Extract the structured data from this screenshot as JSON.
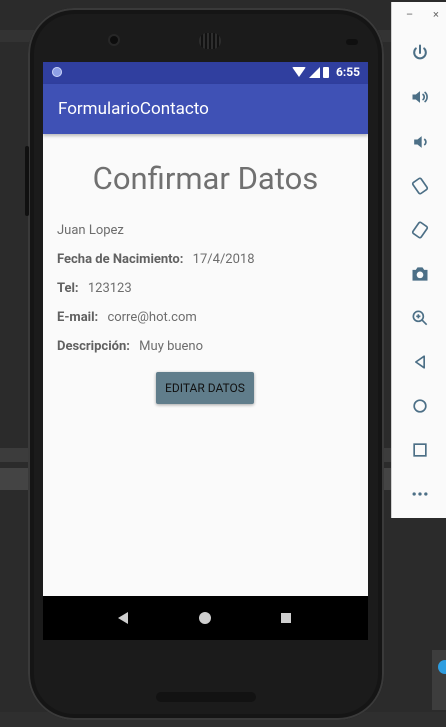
{
  "status_bar": {
    "time": "6:55"
  },
  "app_bar": {
    "title": "FormularioContacto"
  },
  "screen": {
    "heading": "Confirmar Datos",
    "name": "Juan Lopez",
    "birth_label": "Fecha de Nacimiento:",
    "birth_value": "17/4/2018",
    "tel_label": "Tel:",
    "tel_value": "123123",
    "email_label": "E-mail:",
    "email_value": "corre@hot.com",
    "desc_label": "Descripción:",
    "desc_value": "Muy bueno",
    "edit_button": "EDITAR DATOS"
  },
  "emulator_toolbar": {
    "minimize": "–",
    "close": "×",
    "buttons": [
      "power-icon",
      "volume-up-icon",
      "volume-down-icon",
      "rotate-left-icon",
      "rotate-right-icon",
      "camera-icon",
      "zoom-icon",
      "back-icon",
      "home-icon",
      "overview-icon",
      "more-icon"
    ]
  },
  "colors": {
    "status_bar": "#303f9f",
    "app_bar": "#3f51b5",
    "button": "#607d8b"
  }
}
